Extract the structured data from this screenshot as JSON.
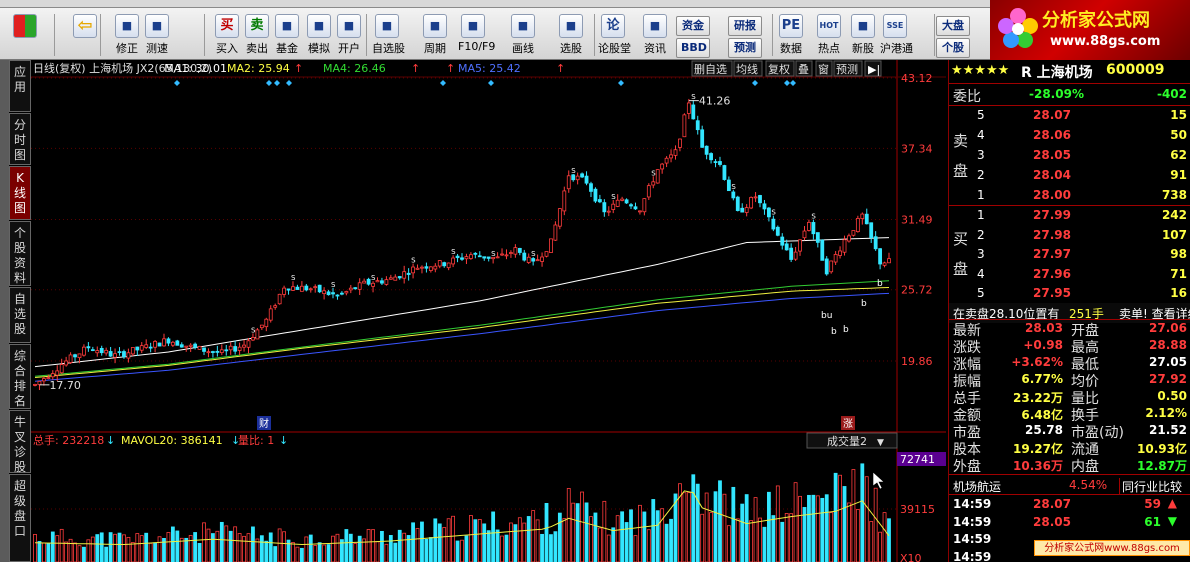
{
  "toolbar": {
    "buttons": [
      {
        "label": "",
        "icon": "color-block-icon"
      },
      {
        "label": "",
        "icon": "back-arrow-icon"
      },
      {
        "label": "修正",
        "icon": "revise-icon"
      },
      {
        "label": "测速",
        "icon": "speed-test-icon"
      },
      {
        "label": "买入",
        "icon": "buy-icon",
        "glyph": "买"
      },
      {
        "label": "卖出",
        "icon": "sell-icon",
        "glyph": "卖"
      },
      {
        "label": "基金",
        "icon": "fund-icon"
      },
      {
        "label": "模拟",
        "icon": "simulate-icon"
      },
      {
        "label": "开户",
        "icon": "lock-icon"
      },
      {
        "label": "自选股",
        "icon": "watchlist-icon"
      },
      {
        "label": "周期",
        "icon": "period-icon"
      },
      {
        "label": "F10/F9",
        "icon": "f10-icon"
      },
      {
        "label": "画线",
        "icon": "draw-line-icon"
      },
      {
        "label": "选股",
        "icon": "stock-picker-icon"
      },
      {
        "label": "论股堂",
        "icon": "forum-icon",
        "glyph": "论"
      },
      {
        "label": "资讯",
        "icon": "news-icon"
      },
      {
        "label": "数据",
        "icon": "data-icon",
        "glyph": "PE"
      },
      {
        "label": "热点",
        "icon": "hotspot-icon",
        "glyph": "HOT"
      },
      {
        "label": "新股",
        "icon": "ipo-icon"
      },
      {
        "label": "沪港通",
        "icon": "hk-connect-icon",
        "glyph": "SSE"
      }
    ],
    "small_buttons": [
      "资金",
      "研报",
      "BBD",
      "预测",
      "大盘",
      "个股"
    ]
  },
  "logo": {
    "title": "分析家公式网",
    "url": "www.88gs.com"
  },
  "side_tabs": [
    "应用",
    "分时图",
    "K线图",
    "个股资料",
    "自选股",
    "综合排名",
    "牛叉诊股",
    "超级盘口"
  ],
  "chart_header": {
    "title": "日线(复权) 上海机场 JX2(65,130,2)",
    "ma1": "MA1: 30.01",
    "ma2": "MA2: 25.94",
    "ma4": "MA4: 26.46",
    "ma5": "MA5: 25.42",
    "buttons": [
      "删自选",
      "均线",
      "复权",
      "叠",
      "窗",
      "预测"
    ]
  },
  "chart_data": {
    "type": "candlestick",
    "y_ticks": [
      "43.12",
      "37.34",
      "31.49",
      "25.72",
      "19.86"
    ],
    "y_range": [
      19.86,
      43.12
    ],
    "high_label": "41.26",
    "low_label": "17.70",
    "markers": [
      "财",
      "涨"
    ],
    "signal_text": [
      "S",
      "b",
      "bu"
    ],
    "ohlc_keypoints": [
      [
        0,
        17.9
      ],
      [
        6,
        19.6
      ],
      [
        12,
        21.0
      ],
      [
        18,
        20.3
      ],
      [
        24,
        20.9
      ],
      [
        30,
        21.6
      ],
      [
        36,
        20.9
      ],
      [
        42,
        20.5
      ],
      [
        47,
        21.2
      ],
      [
        52,
        23.2
      ],
      [
        56,
        26.0
      ],
      [
        62,
        25.8
      ],
      [
        68,
        25.2
      ],
      [
        74,
        26.2
      ],
      [
        80,
        26.6
      ],
      [
        86,
        27.6
      ],
      [
        92,
        27.9
      ],
      [
        98,
        28.6
      ],
      [
        104,
        28.3
      ],
      [
        108,
        29.0
      ],
      [
        112,
        27.8
      ],
      [
        116,
        29.6
      ],
      [
        120,
        35.2
      ],
      [
        124,
        34.6
      ],
      [
        128,
        32.0
      ],
      [
        132,
        33.2
      ],
      [
        136,
        32.4
      ],
      [
        140,
        35.6
      ],
      [
        144,
        37.0
      ],
      [
        147,
        41.2
      ],
      [
        150,
        37.4
      ],
      [
        154,
        36.0
      ],
      [
        158,
        32.0
      ],
      [
        162,
        33.4
      ],
      [
        166,
        30.8
      ],
      [
        170,
        28.2
      ],
      [
        174,
        31.4
      ],
      [
        178,
        27.3
      ],
      [
        182,
        29.8
      ],
      [
        186,
        31.8
      ],
      [
        190,
        28.0
      ],
      [
        192,
        28.03
      ]
    ],
    "ma1_points": [
      [
        0,
        19.4
      ],
      [
        30,
        20.6
      ],
      [
        60,
        22.4
      ],
      [
        100,
        24.8
      ],
      [
        140,
        27.8
      ],
      [
        160,
        29.6
      ],
      [
        192,
        30.0
      ]
    ],
    "ma2_points": [
      [
        0,
        18.5
      ],
      [
        30,
        19.5
      ],
      [
        60,
        20.9
      ],
      [
        100,
        22.6
      ],
      [
        140,
        24.6
      ],
      [
        170,
        25.6
      ],
      [
        192,
        25.9
      ]
    ],
    "ma4_points": [
      [
        0,
        18.6
      ],
      [
        30,
        19.6
      ],
      [
        60,
        21.0
      ],
      [
        100,
        22.8
      ],
      [
        140,
        24.9
      ],
      [
        170,
        26.0
      ],
      [
        192,
        26.46
      ]
    ],
    "ma5_points": [
      [
        0,
        18.2
      ],
      [
        30,
        19.1
      ],
      [
        60,
        20.4
      ],
      [
        100,
        22.1
      ],
      [
        140,
        24.0
      ],
      [
        170,
        25.0
      ],
      [
        192,
        25.42
      ]
    ],
    "volume": {
      "header_total": "总手: 232218",
      "header_mavol": "MAVOL20: 386141",
      "header_ratio": "量比: 1",
      "selector": "成交量2",
      "y_ticks": [
        "72741",
        "39115",
        "X10"
      ],
      "bars_keypoints": [
        [
          0,
          0.22
        ],
        [
          20,
          0.2
        ],
        [
          40,
          0.26
        ],
        [
          60,
          0.2
        ],
        [
          80,
          0.24
        ],
        [
          100,
          0.32
        ],
        [
          115,
          0.38
        ],
        [
          120,
          0.5
        ],
        [
          130,
          0.36
        ],
        [
          140,
          0.42
        ],
        [
          147,
          0.88
        ],
        [
          150,
          0.62
        ],
        [
          160,
          0.44
        ],
        [
          170,
          0.52
        ],
        [
          180,
          0.58
        ],
        [
          186,
          0.7
        ],
        [
          192,
          0.3
        ]
      ]
    }
  },
  "stock_info": {
    "name": "R 上海机场",
    "code": "600009",
    "stars": "★★★★★",
    "weibi_label": "委比",
    "weibi_pct": "-28.09%",
    "weibi_val": "-402",
    "sell_label": "卖盘",
    "buy_label": "买盘",
    "sell_orders": [
      {
        "lvl": "5",
        "price": "28.07",
        "vol": "15"
      },
      {
        "lvl": "4",
        "price": "28.06",
        "vol": "50"
      },
      {
        "lvl": "3",
        "price": "28.05",
        "vol": "62"
      },
      {
        "lvl": "2",
        "price": "28.04",
        "vol": "91"
      },
      {
        "lvl": "1",
        "price": "28.00",
        "vol": "738"
      }
    ],
    "buy_orders": [
      {
        "lvl": "1",
        "price": "27.99",
        "vol": "242"
      },
      {
        "lvl": "2",
        "price": "27.98",
        "vol": "107"
      },
      {
        "lvl": "3",
        "price": "27.97",
        "vol": "98"
      },
      {
        "lvl": "4",
        "price": "27.96",
        "vol": "71"
      },
      {
        "lvl": "5",
        "price": "27.95",
        "vol": "16"
      }
    ],
    "pending_text": "在卖盘28.10位置有",
    "pending_vol": "251手",
    "pending_link": "卖单! 查看详细",
    "quote_rows": [
      {
        "l1": "最新",
        "v1": "28.03",
        "c1": "up",
        "l2": "开盘",
        "v2": "27.06",
        "c2": "up"
      },
      {
        "l1": "涨跌",
        "v1": "+0.98",
        "c1": "up",
        "l2": "最高",
        "v2": "28.88",
        "c2": "up"
      },
      {
        "l1": "涨幅",
        "v1": "+3.62%",
        "c1": "up",
        "l2": "最低",
        "v2": "27.05",
        "c2": "wt"
      },
      {
        "l1": "振幅",
        "v1": "6.77%",
        "c1": "yw",
        "l2": "均价",
        "v2": "27.92",
        "c2": "up"
      },
      {
        "l1": "总手",
        "v1": "23.22万",
        "c1": "yw",
        "l2": "量比",
        "v2": "0.50",
        "c2": "yw"
      },
      {
        "l1": "金额",
        "v1": "6.48亿",
        "c1": "yw",
        "l2": "换手",
        "v2": "2.12%",
        "c2": "yw"
      },
      {
        "l1": "市盈",
        "v1": "25.78",
        "c1": "wt",
        "l2": "市盈(动)",
        "v2": "21.52",
        "c2": "wt"
      },
      {
        "l1": "股本",
        "v1": "19.27亿",
        "c1": "yw",
        "l2": "流通",
        "v2": "10.93亿",
        "c2": "yw"
      },
      {
        "l1": "外盘",
        "v1": "10.36万",
        "c1": "up",
        "l2": "内盘",
        "v2": "12.87万",
        "c2": "dn"
      }
    ],
    "sector_name": "机场航运",
    "sector_pct": "4.54%",
    "sector_compare": "同行业比较",
    "ticks": [
      {
        "time": "14:59",
        "price": "28.07",
        "vol": "59",
        "dir": "up"
      },
      {
        "time": "14:59",
        "price": "28.05",
        "vol": "61",
        "dir": "down"
      },
      {
        "time": "14:59",
        "price": "",
        "vol": "",
        "dir": ""
      },
      {
        "time": "14:59",
        "price": "",
        "vol": "",
        "dir": ""
      }
    ]
  },
  "watermark": "分析家公式网www.88gs.com",
  "colors": {
    "up": "#ff3c3c",
    "down": "#33e6ff",
    "ma1": "#ffffff",
    "ma2": "#ffff44",
    "ma4": "#33dd33",
    "ma5": "#4060ff",
    "grid": "#8b0000"
  }
}
